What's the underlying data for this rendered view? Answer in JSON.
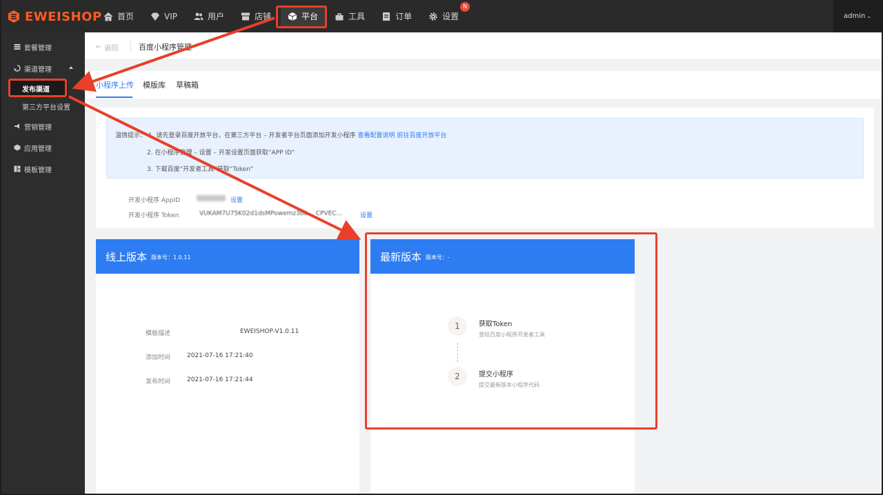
{
  "brand": {
    "name": "EWEISHOP"
  },
  "topnav": {
    "items": [
      {
        "label": "首页",
        "icon": "home-icon"
      },
      {
        "label": "VIP",
        "icon": "diamond-icon"
      },
      {
        "label": "用户",
        "icon": "users-icon"
      },
      {
        "label": "店铺",
        "icon": "store-icon"
      },
      {
        "label": "平台",
        "icon": "cube-icon"
      },
      {
        "label": "工具",
        "icon": "toolbox-icon"
      },
      {
        "label": "订单",
        "icon": "order-icon"
      },
      {
        "label": "设置",
        "icon": "gear-icon"
      }
    ],
    "settings_badge": "N",
    "user": "admin"
  },
  "sidebar": {
    "items": [
      {
        "label": "套餐管理",
        "icon": "package-icon"
      },
      {
        "label": "渠道管理",
        "icon": "channel-icon"
      },
      {
        "label": "营销管理",
        "icon": "marketing-icon"
      },
      {
        "label": "应用管理",
        "icon": "apps-icon"
      },
      {
        "label": "模板管理",
        "icon": "template-icon"
      }
    ],
    "sub_items": [
      "发布渠道",
      "第三方平台设置"
    ]
  },
  "breadcrumb": {
    "back": "返回",
    "title": "百度小程序管理"
  },
  "tabs": [
    "小程序上传",
    "模版库",
    "草稿箱"
  ],
  "tip": {
    "line1_prefix": "温情提示：",
    "line1": "1. 请先登录百度开放平台，在第三方平台 – 开发者平台页面添加开发小程序",
    "link1": "查看配置说明",
    "link2": "前往百度开放平台",
    "line2": "2. 在小程序管理 – 设置 – 开发设置页面获取“APP ID”",
    "line3": "3. 下载百度“开发者工具”获取“Token”"
  },
  "config": {
    "appid_label": "开发小程序 AppID",
    "token_label": "开发小程序 Token",
    "token_value": "VUKAM7U75K02d1dsMPowemz3bb... CPVEC...",
    "set_link": "设置"
  },
  "online": {
    "title": "线上版本",
    "version_label": "版本号：1.0.11",
    "fields": [
      {
        "label": "模板描述",
        "value": "EWEISHOP-V1.0.11"
      },
      {
        "label": "添加时间",
        "value": "2021-07-16 17:21:40"
      },
      {
        "label": "发布时间",
        "value": "2021-07-16 17:21:44"
      }
    ]
  },
  "latest": {
    "title": "最新版本",
    "version_label": "版本号：-",
    "steps": [
      {
        "num": "1",
        "title": "获取Token",
        "desc": "登陆百度小程序开发者工具"
      },
      {
        "num": "2",
        "title": "提交小程序",
        "desc": "提交最新版本小程序代码"
      }
    ]
  },
  "colors": {
    "accent": "#2d7cf1",
    "brand": "#ff5a1f",
    "annotation": "#e8402a"
  }
}
